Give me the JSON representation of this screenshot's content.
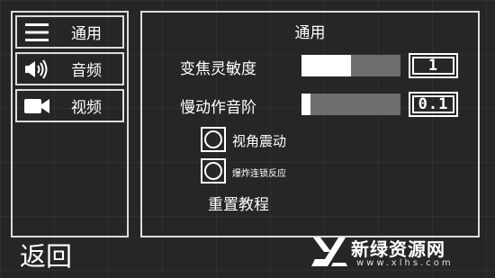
{
  "nav": {
    "general": {
      "icon": "hamburger-menu-icon",
      "label": "通用"
    },
    "audio": {
      "icon": "speaker-icon",
      "label": "音频"
    },
    "video": {
      "icon": "video-camera-icon",
      "label": "视频"
    }
  },
  "back_label": "返回",
  "panel": {
    "title": "通用",
    "zoom_sensitivity": {
      "label": "变焦灵敏度",
      "value": "1",
      "fill_fraction": 0.5
    },
    "slowmo_pitch": {
      "label": "慢动作音阶",
      "value": "0.1",
      "fill_fraction": 0.09
    },
    "camera_shake": {
      "label": "视角震动",
      "checked": false
    },
    "chain_explosion": {
      "label": "爆炸连锁反应",
      "checked": false
    },
    "reset_tutorial_label": "重置教程"
  },
  "watermark": {
    "title": "新绿资源网",
    "url": "www.xlhs.com"
  }
}
